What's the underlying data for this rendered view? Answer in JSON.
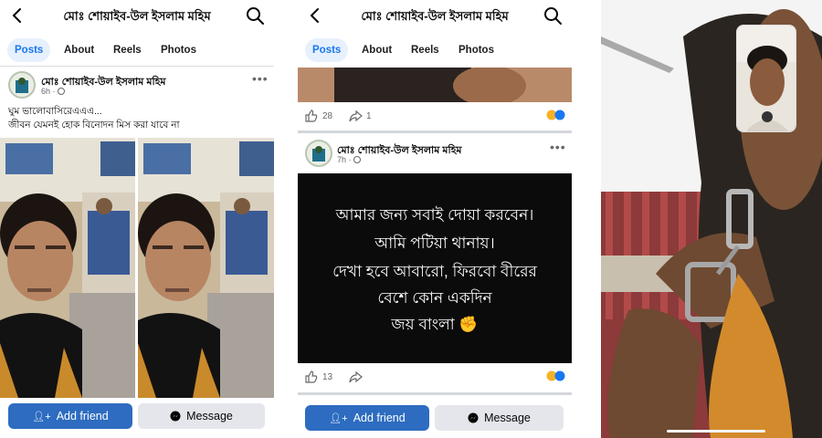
{
  "profile": {
    "name": "মোঃ শোয়াইব-উল ইসলাম মহিম"
  },
  "tabs": [
    "Posts",
    "About",
    "Reels",
    "Photos"
  ],
  "post1": {
    "author": "মোঃ শোয়াইব-উল ইসলাম মহিম",
    "time": "6h · ",
    "line1": "ঘুম ভালোবাসিরেএএএ...",
    "line2": "জীবন যেমনই হোক বিনোদন মিস করা যাবে না"
  },
  "post0": {
    "likes": "28",
    "shares": "1"
  },
  "post2": {
    "author": "মোঃ শোয়াইব-উল ইসলাম মহিম",
    "time": "7h · ",
    "quote_lines": [
      "আমার জন্য সবাই দোয়া করবেন।",
      "আমি পটিয়া থানায়।",
      "দেখা হবে আবারো, ফিরবো বীরের",
      "বেশে কোন একদিন",
      "জয় বাংলা ✊"
    ],
    "likes": "13"
  },
  "buttons": {
    "add_friend": "Add friend",
    "message": "Message"
  },
  "colors": {
    "accent": "#1877f2",
    "primary_button": "#2d6cc0",
    "secondary_button": "#e4e6eb"
  }
}
